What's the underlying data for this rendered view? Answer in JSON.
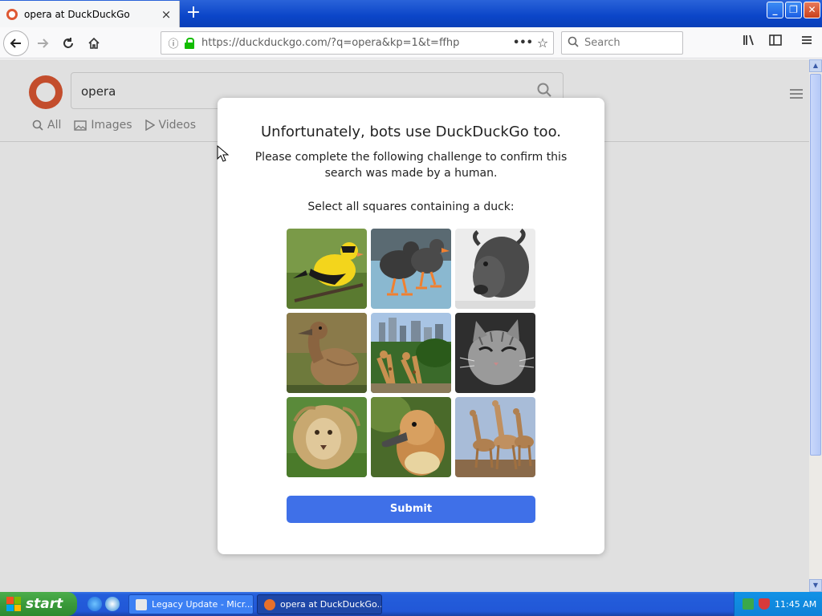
{
  "browser": {
    "tab_title": "opera at DuckDuckGo",
    "tab_close": "×",
    "new_tab": "+",
    "url": "https://duckduckgo.com/?q=opera&kp=1&t=ffhp",
    "search_placeholder": "Search",
    "page_actions": "•••",
    "bookmark_star": "☆",
    "window_controls": {
      "minimize": "_",
      "restore": "❐",
      "close": "✕"
    }
  },
  "ddg": {
    "query": "opera",
    "tabs": [
      {
        "label": "All",
        "icon": "search-icon"
      },
      {
        "label": "Images",
        "icon": "image-icon"
      },
      {
        "label": "Videos",
        "icon": "play-icon"
      }
    ]
  },
  "modal": {
    "title": "Unfortunately, bots use DuckDuckGo too.",
    "subtitle": "Please complete the following challenge to confirm this search was made by a human.",
    "prompt": "Select all squares containing a duck:",
    "submit_label": "Submit",
    "tiles": [
      {
        "subject": "goldfinch bird",
        "bg": "#6d8a3c",
        "fg": "#f3d51c"
      },
      {
        "subject": "ducks on blue surface",
        "bg": "#8ab8d0",
        "fg": "#3a3a3a"
      },
      {
        "subject": "bison",
        "bg": "#e6e6e6",
        "fg": "#555555"
      },
      {
        "subject": "brown duck",
        "bg": "#6e7a3c",
        "fg": "#a07a50"
      },
      {
        "subject": "giraffes with city skyline",
        "bg": "#4a7a3a",
        "fg": "#c89050"
      },
      {
        "subject": "cat",
        "bg": "#3a3a3a",
        "fg": "#9a9a9a"
      },
      {
        "subject": "lion",
        "bg": "#5a8a3a",
        "fg": "#c8b07a"
      },
      {
        "subject": "duckling",
        "bg": "#4a6a2a",
        "fg": "#c88a4a"
      },
      {
        "subject": "giraffes",
        "bg": "#9ab0d0",
        "fg": "#8a6a40"
      }
    ]
  },
  "taskbar": {
    "start_label": "start",
    "tasks": [
      {
        "label": "Legacy Update - Micr...",
        "active": false
      },
      {
        "label": "opera at DuckDuckGo....",
        "active": true
      }
    ],
    "clock": "11:45 AM"
  },
  "colors": {
    "submit": "#3f70e8",
    "ddg_orange": "#de5833",
    "taskbar_blue": "#245edb",
    "start_green": "#3a9a3a"
  }
}
